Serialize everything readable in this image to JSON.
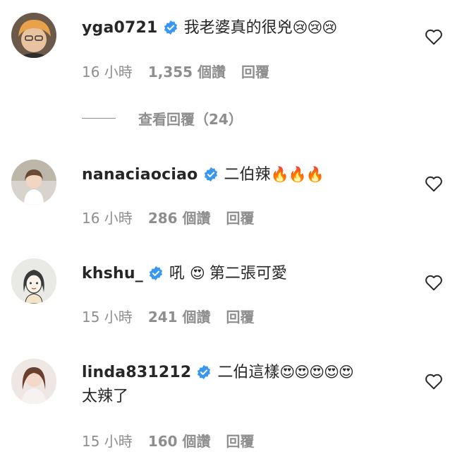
{
  "comments": [
    {
      "username": "yga0721",
      "text": "我老婆真的很兇",
      "emoji": "😢😢😢",
      "time": "16 小時",
      "likes": "1,355 個讚",
      "reply": "回覆",
      "avatar_icon": "avatar-male-orange-hair"
    },
    {
      "username": "nanaciaociao",
      "text": "二伯辣",
      "emoji": "🔥🔥🔥",
      "time": "16 小時",
      "likes": "286 個讚",
      "reply": "回覆",
      "avatar_icon": "avatar-female-photo"
    },
    {
      "username": "khshu_",
      "text_prefix": "吼",
      "emoji": "😍",
      "text": "第二張可愛",
      "time": "15 小時",
      "likes": "241 個讚",
      "reply": "回覆",
      "avatar_icon": "avatar-drawn-girl"
    },
    {
      "username": "linda831212",
      "text": "二伯這樣",
      "emoji": "😍😍😍😍😍",
      "text2": "太辣了",
      "time": "15 小時",
      "likes": "160 個讚",
      "reply": "回覆",
      "avatar_icon": "avatar-female-photo-2"
    }
  ],
  "view_replies": "查看回覆（24）",
  "colors": {
    "verified": "#3897f0",
    "meta": "#8e8e8e",
    "text": "#262626"
  }
}
